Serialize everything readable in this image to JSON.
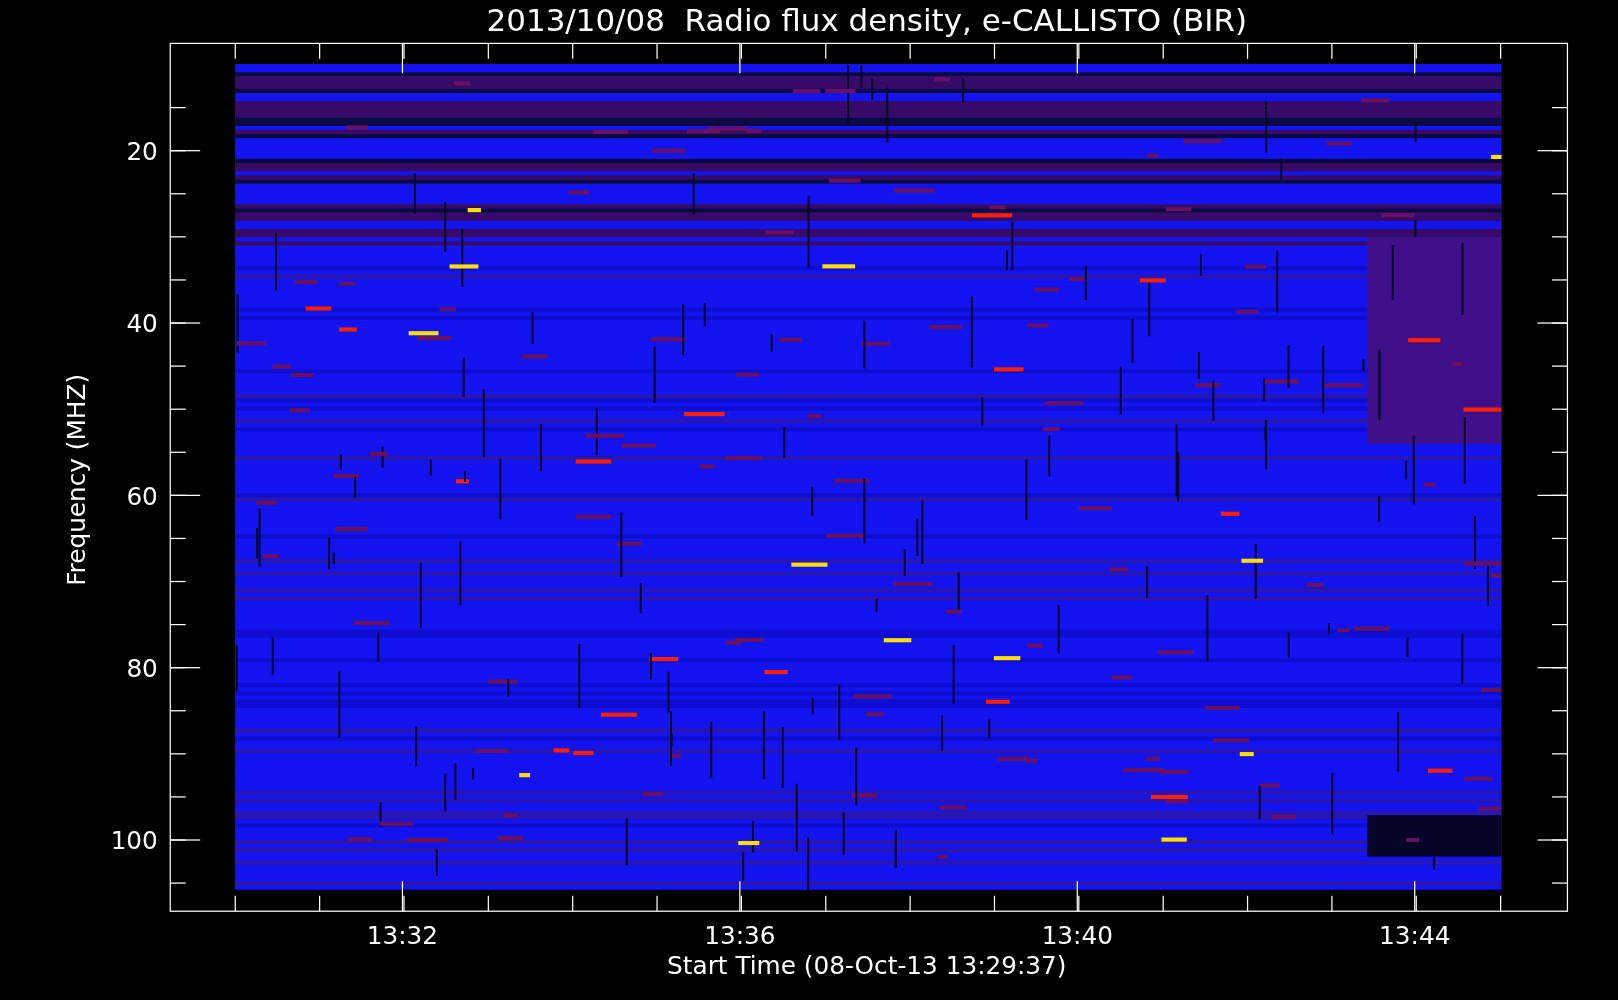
{
  "title": "2013/10/08  Radio flux density, e-CALLISTO (BIR)",
  "y_axis": {
    "label": "Frequency (MHZ)",
    "ticks": [
      "20",
      "40",
      "60",
      "80",
      "100"
    ]
  },
  "x_axis": {
    "label": "Start Time (08-Oct-13 13:29:37)",
    "ticks": [
      "13:32",
      "13:36",
      "13:40",
      "13:44"
    ]
  }
}
